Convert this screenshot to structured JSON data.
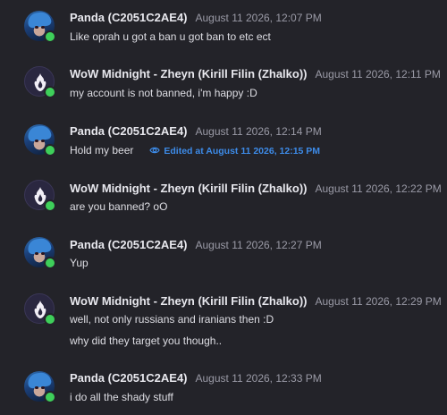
{
  "messages": [
    {
      "author": "Panda (C2051C2AE4)",
      "time": "August 11 2026, 12:07 PM",
      "lines": [
        "Like oprah u got a ban u got ban to etc ect"
      ]
    },
    {
      "author": "WoW Midnight - Zheyn (Kirill Filin (Zhalko))",
      "time": "August 11 2026, 12:11 PM",
      "lines": [
        "my account is not banned, i'm happy :D"
      ]
    },
    {
      "author": "Panda (C2051C2AE4)",
      "time": "August 11 2026, 12:14 PM",
      "lines": [
        "Hold my beer"
      ],
      "edited": "Edited at August 11 2026, 12:15 PM"
    },
    {
      "author": "WoW Midnight - Zheyn (Kirill Filin (Zhalko))",
      "time": "August 11 2026, 12:22 PM",
      "lines": [
        "are you banned? oO"
      ]
    },
    {
      "author": "Panda (C2051C2AE4)",
      "time": "August 11 2026, 12:27 PM",
      "lines": [
        "Yup"
      ]
    },
    {
      "author": "WoW Midnight - Zheyn (Kirill Filin (Zhalko))",
      "time": "August 11 2026, 12:29 PM",
      "lines": [
        "well, not only russians and iranians then :D",
        "why did they target you though.."
      ]
    },
    {
      "author": "Panda (C2051C2AE4)",
      "time": "August 11 2026, 12:33 PM",
      "lines": [
        "i do all the shady stuff"
      ]
    }
  ],
  "colors": {
    "background": "#232329",
    "online_status": "#3ecf5a",
    "edited_link": "#3d8be8"
  },
  "icons": {
    "panda_avatar": "character-portrait",
    "wow_avatar": "flame-emblem-icon",
    "edited": "eye-icon"
  }
}
